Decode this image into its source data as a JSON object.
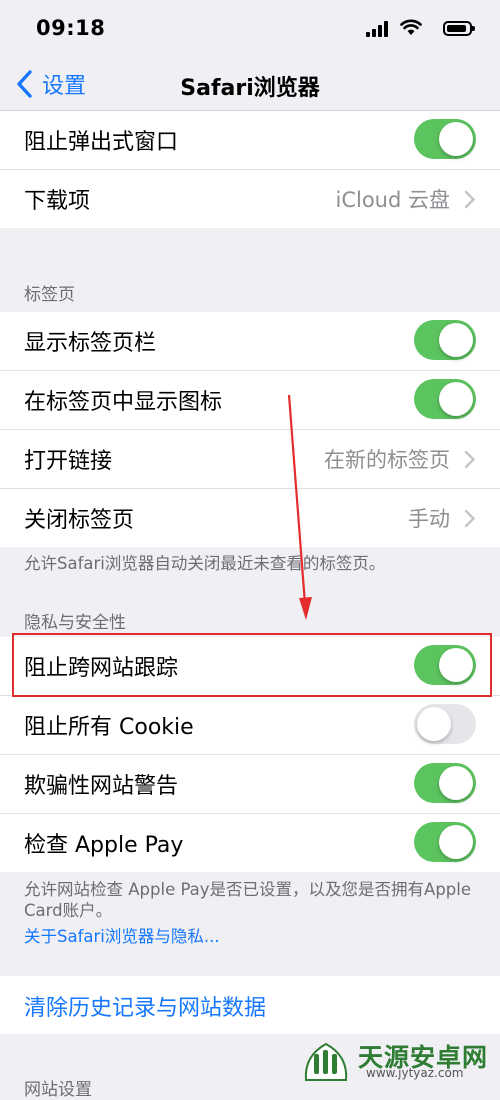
{
  "status": {
    "time": "09:18"
  },
  "nav": {
    "back_label": "设置",
    "title": "Safari浏览器"
  },
  "group_top": {
    "rows": [
      {
        "label": "阻止弹出式窗口",
        "toggle": true
      },
      {
        "label": "下载项",
        "value": "iCloud 云盘"
      }
    ]
  },
  "tabs_section": {
    "header": "标签页",
    "rows": [
      {
        "label": "显示标签页栏",
        "toggle": true
      },
      {
        "label": "在标签页中显示图标",
        "toggle": true
      },
      {
        "label": "打开链接",
        "value": "在新的标签页"
      },
      {
        "label": "关闭标签页",
        "value": "手动"
      }
    ],
    "footer": "允许Safari浏览器自动关闭最近未查看的标签页。"
  },
  "privacy_section": {
    "header": "隐私与安全性",
    "rows": [
      {
        "label": "阻止跨网站跟踪",
        "toggle": true
      },
      {
        "label": "阻止所有 Cookie",
        "toggle": false
      },
      {
        "label": "欺骗性网站警告",
        "toggle": true
      },
      {
        "label": "检查 Apple Pay",
        "toggle": true
      }
    ],
    "footer": "允许网站检查 Apple Pay是否已设置，以及您是否拥有Apple Card账户。",
    "footer_link": "关于Safari浏览器与隐私..."
  },
  "clear": {
    "label": "清除历史记录与网站数据"
  },
  "next_section": {
    "header": "网站设置"
  },
  "watermark": {
    "title": "天源安卓网",
    "url": "www.jytyaz.com"
  },
  "colors": {
    "accent": "#1677ff",
    "toggle_on": "#5cc45f",
    "annotation": "#e32d2d"
  }
}
